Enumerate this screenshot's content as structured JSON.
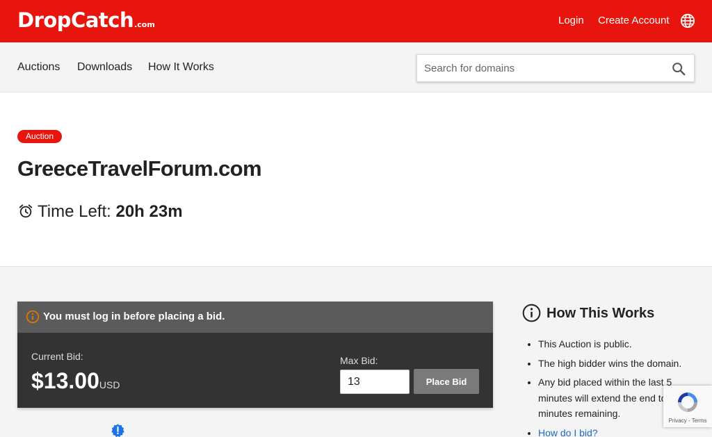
{
  "header": {
    "logo_main": "DropCatch",
    "logo_suffix": ".com",
    "login": "Login",
    "create_account": "Create Account",
    "globe_icon": "globe-icon"
  },
  "nav": {
    "items": [
      {
        "label": "Auctions"
      },
      {
        "label": "Downloads"
      },
      {
        "label": "How It Works"
      }
    ],
    "search_placeholder": "Search for domains",
    "search_icon": "search-icon"
  },
  "auction": {
    "badge": "Auction",
    "domain": "GreeceTravelForum.com",
    "time_left_label": "Time Left:",
    "time_left_value": "20h 23m"
  },
  "bid": {
    "notice": "You must log in before placing a bid.",
    "current_bid_label": "Current Bid:",
    "current_bid_value": "$13.00",
    "currency": "USD",
    "max_bid_label": "Max Bid:",
    "max_bid_value": "13",
    "place_bid": "Place Bid"
  },
  "how": {
    "title": "How This Works",
    "items": [
      "This Auction is public.",
      "The high bidder wins the domain.",
      "Any bid placed within the last 5 minutes will extend the end to 5 minutes remaining."
    ],
    "link": "How do I bid?"
  },
  "recaptcha": {
    "text": "Privacy - Terms"
  },
  "colors": {
    "brand_red": "#e8140e",
    "link_blue": "#1a6ac2",
    "notice_orange": "#e07b00"
  }
}
